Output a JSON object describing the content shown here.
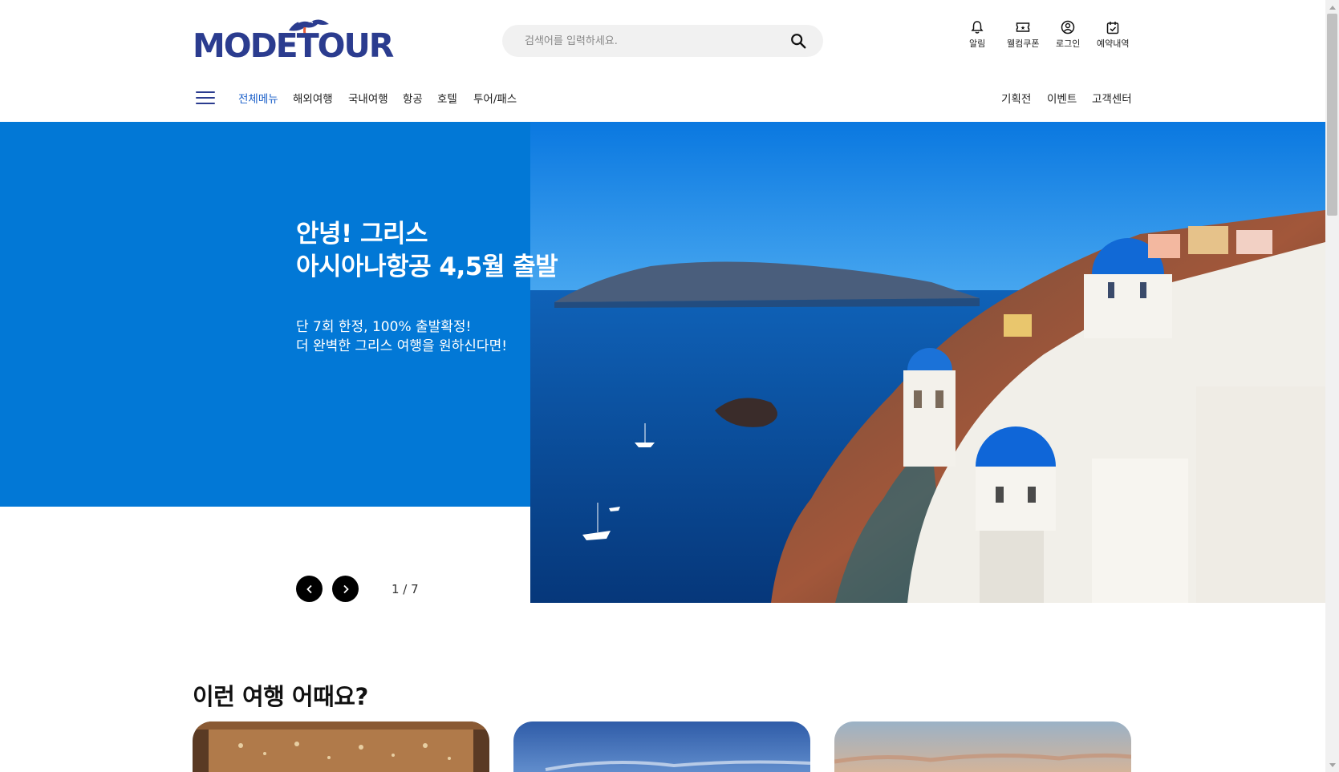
{
  "brand": {
    "logo_text": "MODETOUR"
  },
  "search": {
    "placeholder": "검색어를 입력하세요."
  },
  "utility": [
    {
      "label": "알림",
      "icon": "bell-icon"
    },
    {
      "label": "웰컴쿠폰",
      "icon": "ticket-icon"
    },
    {
      "label": "로그인",
      "icon": "user-icon"
    },
    {
      "label": "예약내역",
      "icon": "calendar-icon"
    }
  ],
  "nav": {
    "items": [
      "전체메뉴",
      "해외여행",
      "국내여행",
      "항공",
      "호텔",
      "투어/패스"
    ],
    "right_items": [
      "기획전",
      "이벤트",
      "고객센터"
    ]
  },
  "hero": {
    "title_line1": "안녕! 그리스",
    "title_line2": "아시아나항공 4,5월 출발",
    "sub_line1": "단 7회 한정, 100% 출발확정!",
    "sub_line2": "더 완벽한 그리스 여행을 원하신다면!",
    "pager": "1 / 7",
    "bg_color": "#0278d6"
  },
  "section": {
    "title": "이런 여행 어때요?"
  },
  "colors": {
    "brand": "#2b3c8f",
    "accent": "#e8603c",
    "active_nav": "#1a5fc9"
  }
}
